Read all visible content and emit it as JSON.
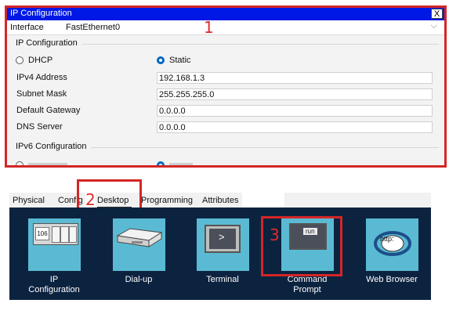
{
  "window": {
    "title": "IP Configuration",
    "close_label": "X",
    "interface_label": "Interface",
    "interface_value": "FastEthernet0",
    "interface_chevron": "⌵"
  },
  "ipv4": {
    "section_title": "IP Configuration",
    "dhcp_label": "DHCP",
    "static_label": "Static",
    "selected_mode": "Static",
    "fields": [
      {
        "label": "IPv4 Address",
        "value": "192.168.1.3"
      },
      {
        "label": "Subnet Mask",
        "value": "255.255.255.0"
      },
      {
        "label": "Default Gateway",
        "value": "0.0.0.0"
      },
      {
        "label": "DNS Server",
        "value": "0.0.0.0"
      }
    ]
  },
  "ipv6": {
    "section_title": "IPv6 Configuration"
  },
  "annotations": {
    "n1": "1",
    "n2": "2",
    "n3": "3",
    "color": "#d42626"
  },
  "tabs": [
    {
      "label": "Physical"
    },
    {
      "label": "Config"
    },
    {
      "label": "Desktop",
      "active": true
    },
    {
      "label": "Programming"
    },
    {
      "label": "Attributes"
    }
  ],
  "apps": [
    {
      "label": "IP\nConfiguration",
      "icon": "ip-configuration-icon",
      "glyph": "106"
    },
    {
      "label": "Dial-up",
      "icon": "modem-icon"
    },
    {
      "label": "Terminal",
      "icon": "terminal-icon",
      "glyph": ">"
    },
    {
      "label": "Command\nPrompt",
      "icon": "command-prompt-icon",
      "glyph": "run"
    },
    {
      "label": "Web Browser",
      "icon": "web-browser-icon",
      "glyph": "http:"
    }
  ],
  "colors": {
    "titlebar": "#0018e6",
    "desktop_bg": "#0c2340",
    "icon_tile": "#5bbad3",
    "radio_selected": "#0067c0"
  }
}
